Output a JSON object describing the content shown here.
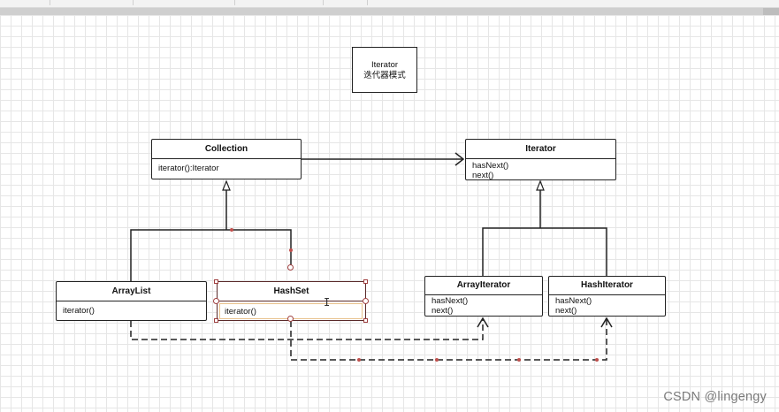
{
  "note": {
    "line1": "Iterator",
    "line2": "迭代器模式"
  },
  "classes": {
    "collection": {
      "name": "Collection",
      "method1": "iterator():Iterator"
    },
    "iterator": {
      "name": "Iterator",
      "method1": "hasNext()",
      "method2": "next()"
    },
    "arraylist": {
      "name": "ArrayList",
      "method1": "iterator()"
    },
    "hashset": {
      "name": "HashSet",
      "method1": "iterator()"
    },
    "arrayiterator": {
      "name": "ArrayIterator",
      "method1": "hasNext()",
      "method2": "next()"
    },
    "hashiterator": {
      "name": "HashIterator",
      "method1": "hasNext()",
      "method2": "next()"
    }
  },
  "watermark": "CSDN @lingengy",
  "colors": {
    "line": "#222222",
    "selection": "#a04040",
    "grid": "#e6e6e6"
  }
}
